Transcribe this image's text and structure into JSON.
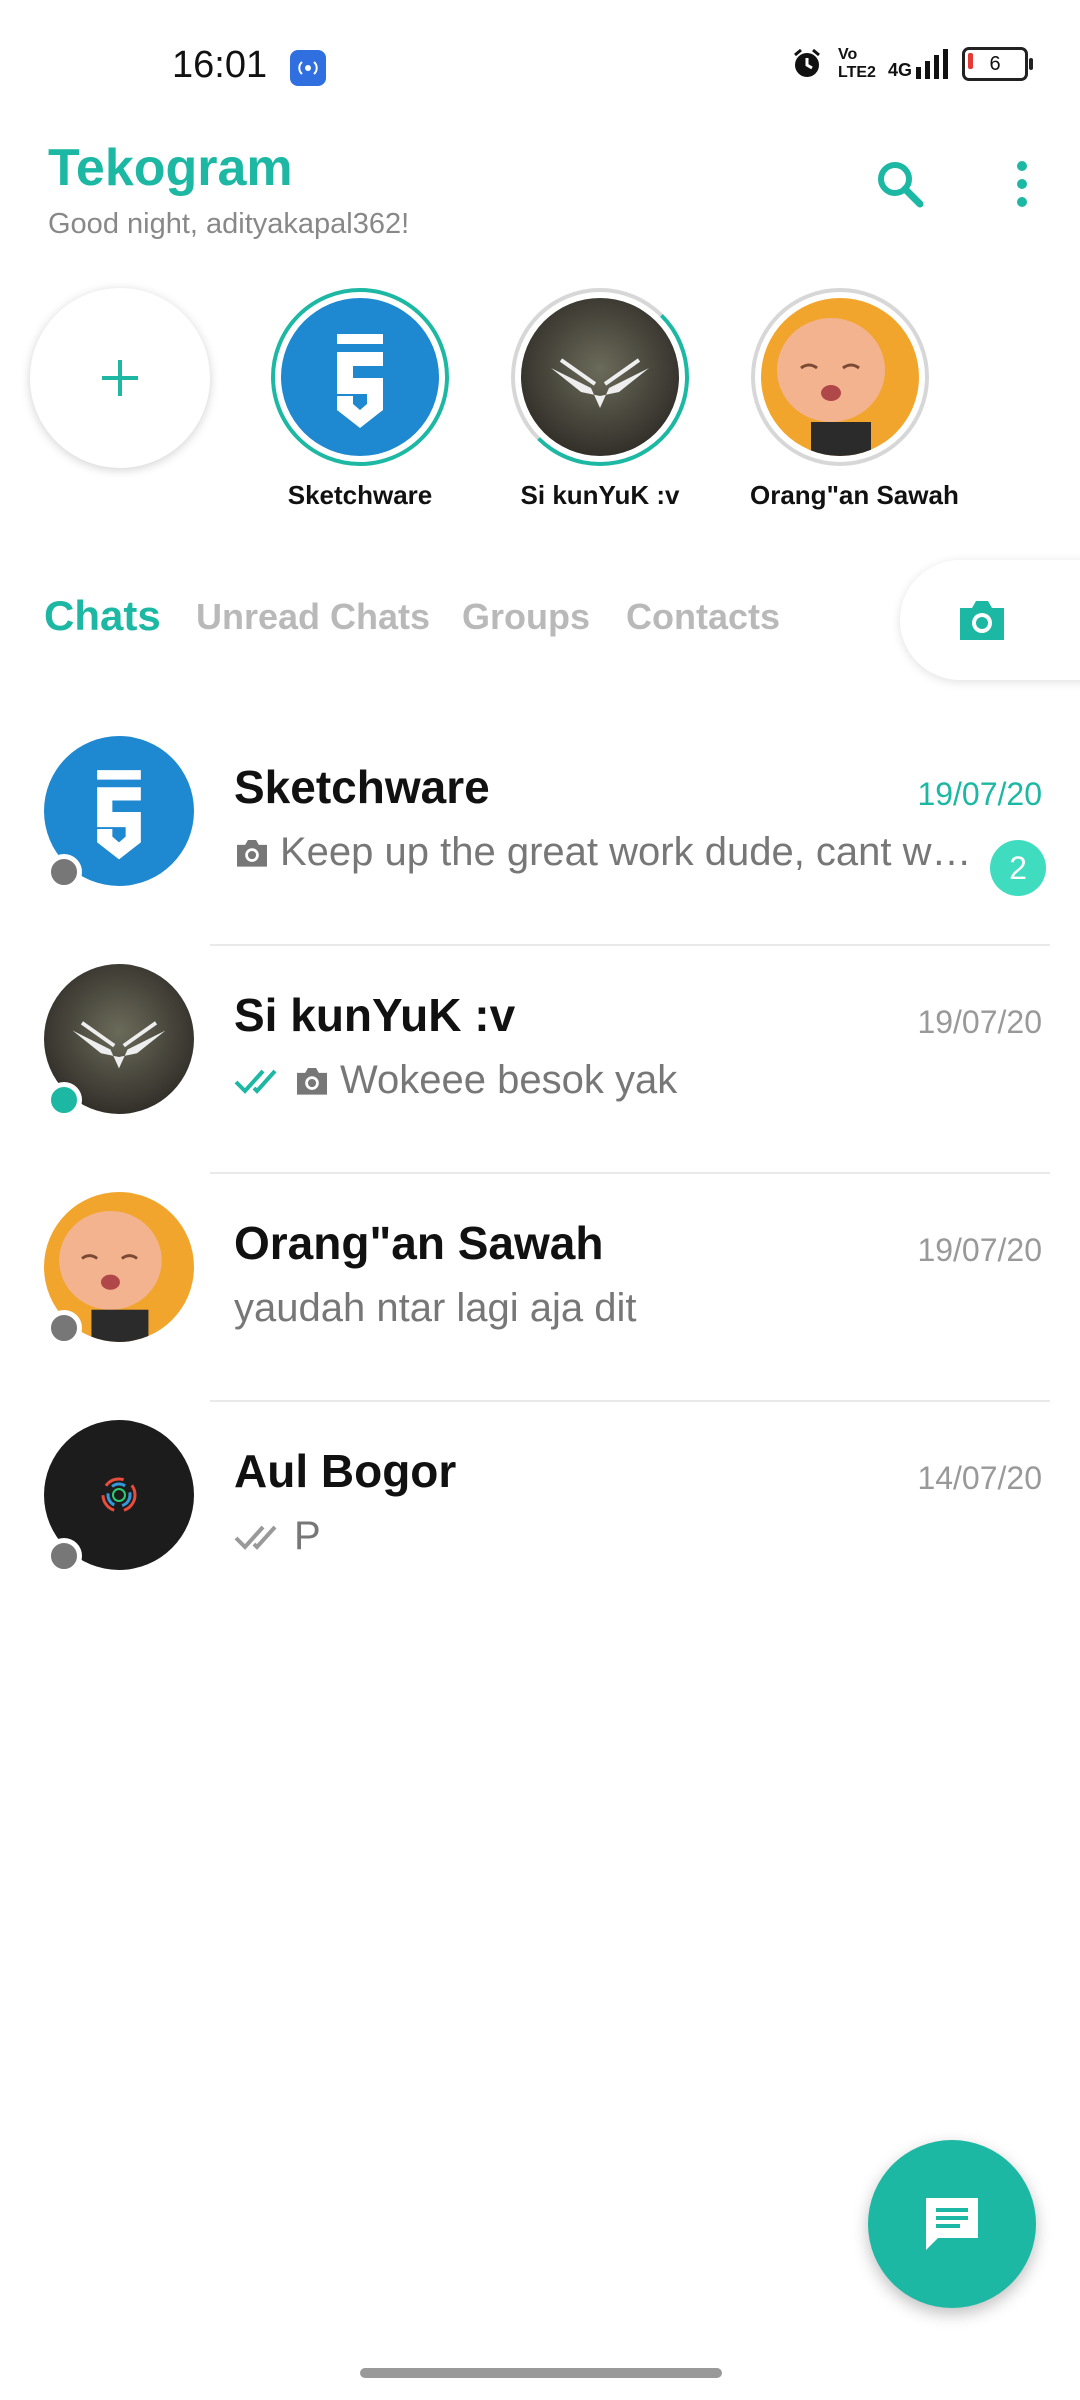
{
  "status_bar": {
    "time": "16:01",
    "network": "4G",
    "volte": "Vo LTE2",
    "battery": "6",
    "icons": [
      "hotspot-icon",
      "alarm-icon",
      "signal-icon",
      "battery-icon"
    ]
  },
  "header": {
    "title": "Tekogram",
    "subtitle": "Good night, adityakapal362!",
    "icons": [
      "search-icon",
      "more-vert-icon"
    ]
  },
  "stories": [
    {
      "label": "Sketchware"
    },
    {
      "label": "Si kunYuK :v"
    },
    {
      "label": "Orang\"an Sawah"
    }
  ],
  "tabs": [
    {
      "label": "Chats",
      "active": true
    },
    {
      "label": "Unread Chats"
    },
    {
      "label": "Groups"
    },
    {
      "label": "Contacts"
    }
  ],
  "chats": [
    {
      "name": "Sketchware",
      "preview": "Keep up the great work dude, cant w…",
      "date": "19/07/20",
      "unread": "2",
      "online": false
    },
    {
      "name": "Si kunYuK :v",
      "preview": "Wokeee besok yak",
      "date": "19/07/20",
      "online": true
    },
    {
      "name": "Orang\"an Sawah",
      "preview": "yaudah ntar lagi aja dit",
      "date": "19/07/20",
      "online": false
    },
    {
      "name": "Aul Bogor",
      "preview": "P",
      "date": "14/07/20",
      "online": false
    }
  ],
  "colors": {
    "accent": "#1db8a3",
    "badge": "#3fdcbf",
    "sketchware_blue": "#1e88d0"
  }
}
